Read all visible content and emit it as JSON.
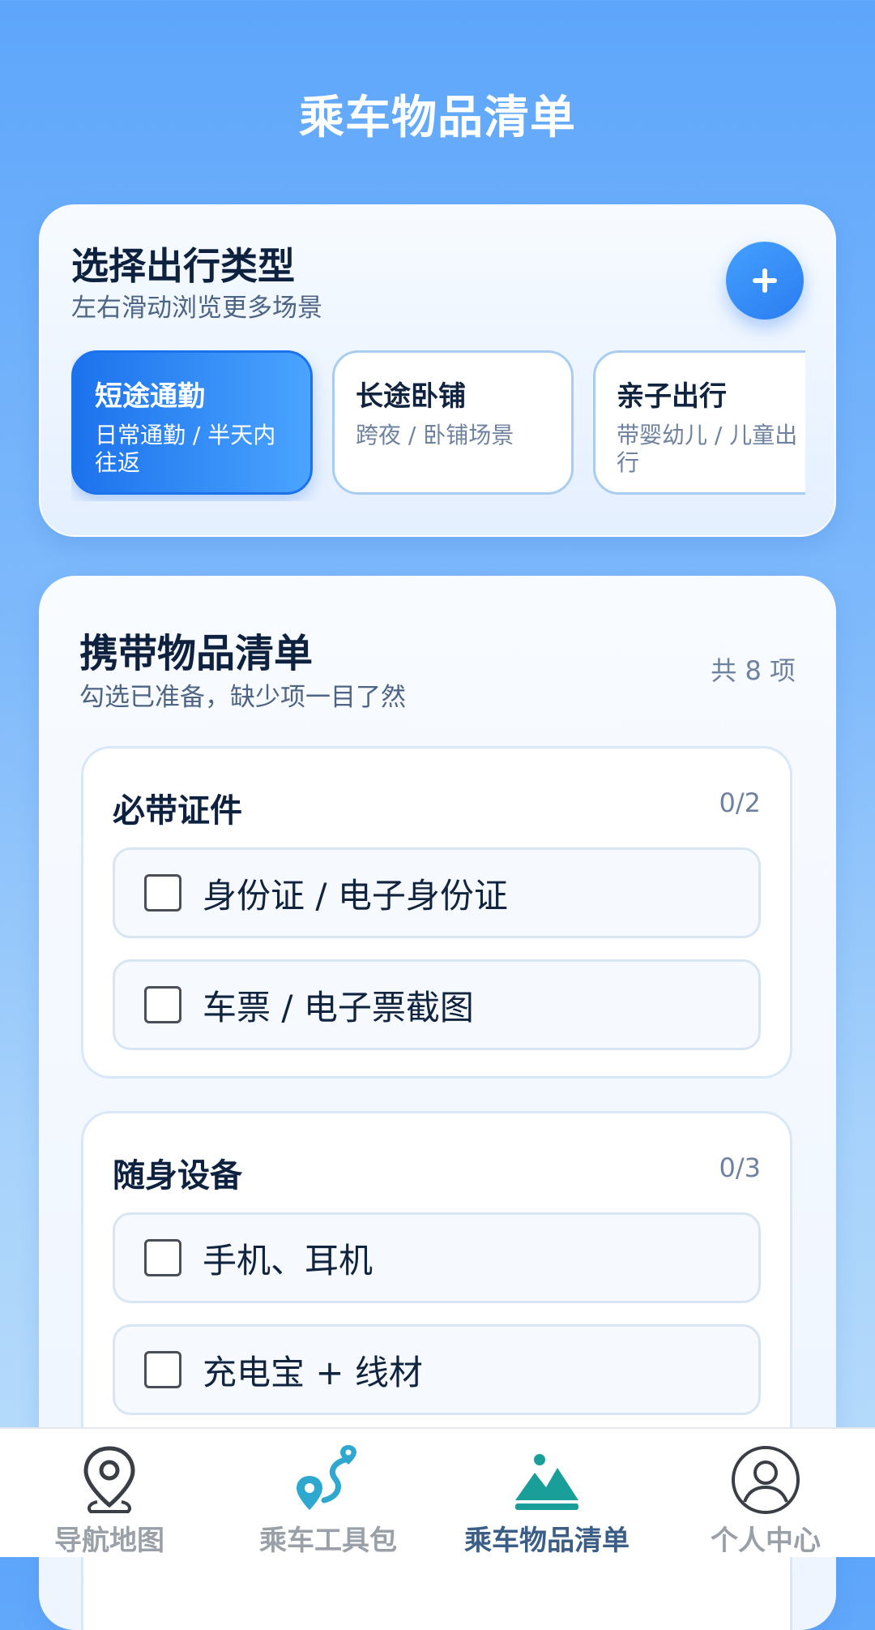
{
  "header": {
    "title": "乘车物品清单"
  },
  "trip_section": {
    "title": "选择出行类型",
    "subtitle": "左右滑动浏览更多场景",
    "add_icon": "plus-icon",
    "types": [
      {
        "name": "短途通勤",
        "desc": "日常通勤 / 半天内往返",
        "selected": true
      },
      {
        "name": "长途卧铺",
        "desc": "跨夜 / 卧铺场景",
        "selected": false
      },
      {
        "name": "亲子出行",
        "desc": "带婴幼儿 / 儿童出行",
        "selected": false
      }
    ]
  },
  "checklist": {
    "title": "携带物品清单",
    "subtitle": "勾选已准备，缺少项一目了然",
    "count": "共 8 项",
    "groups": [
      {
        "title": "必带证件",
        "progress": "0/2",
        "items": [
          {
            "label": "身份证 / 电子身份证",
            "checked": false
          },
          {
            "label": "车票 / 电子票截图",
            "checked": false
          }
        ]
      },
      {
        "title": "随身设备",
        "progress": "0/3",
        "items": [
          {
            "label": "手机、耳机",
            "checked": false
          },
          {
            "label": "充电宝 + 线材",
            "checked": false
          }
        ]
      }
    ]
  },
  "bottom_nav": {
    "items": [
      {
        "label": "导航地图",
        "icon": "map-pin-icon",
        "active": false
      },
      {
        "label": "乘车工具包",
        "icon": "route-icon",
        "active": false
      },
      {
        "label": "乘车物品清单",
        "icon": "mountain-icon",
        "active": true
      },
      {
        "label": "个人中心",
        "icon": "user-icon",
        "active": false
      }
    ]
  },
  "colors": {
    "accent": "#2a7df0",
    "nav_active": "#3c5e86",
    "nav_inactive": "#9aa0a8",
    "teal": "#1a9e9a"
  }
}
